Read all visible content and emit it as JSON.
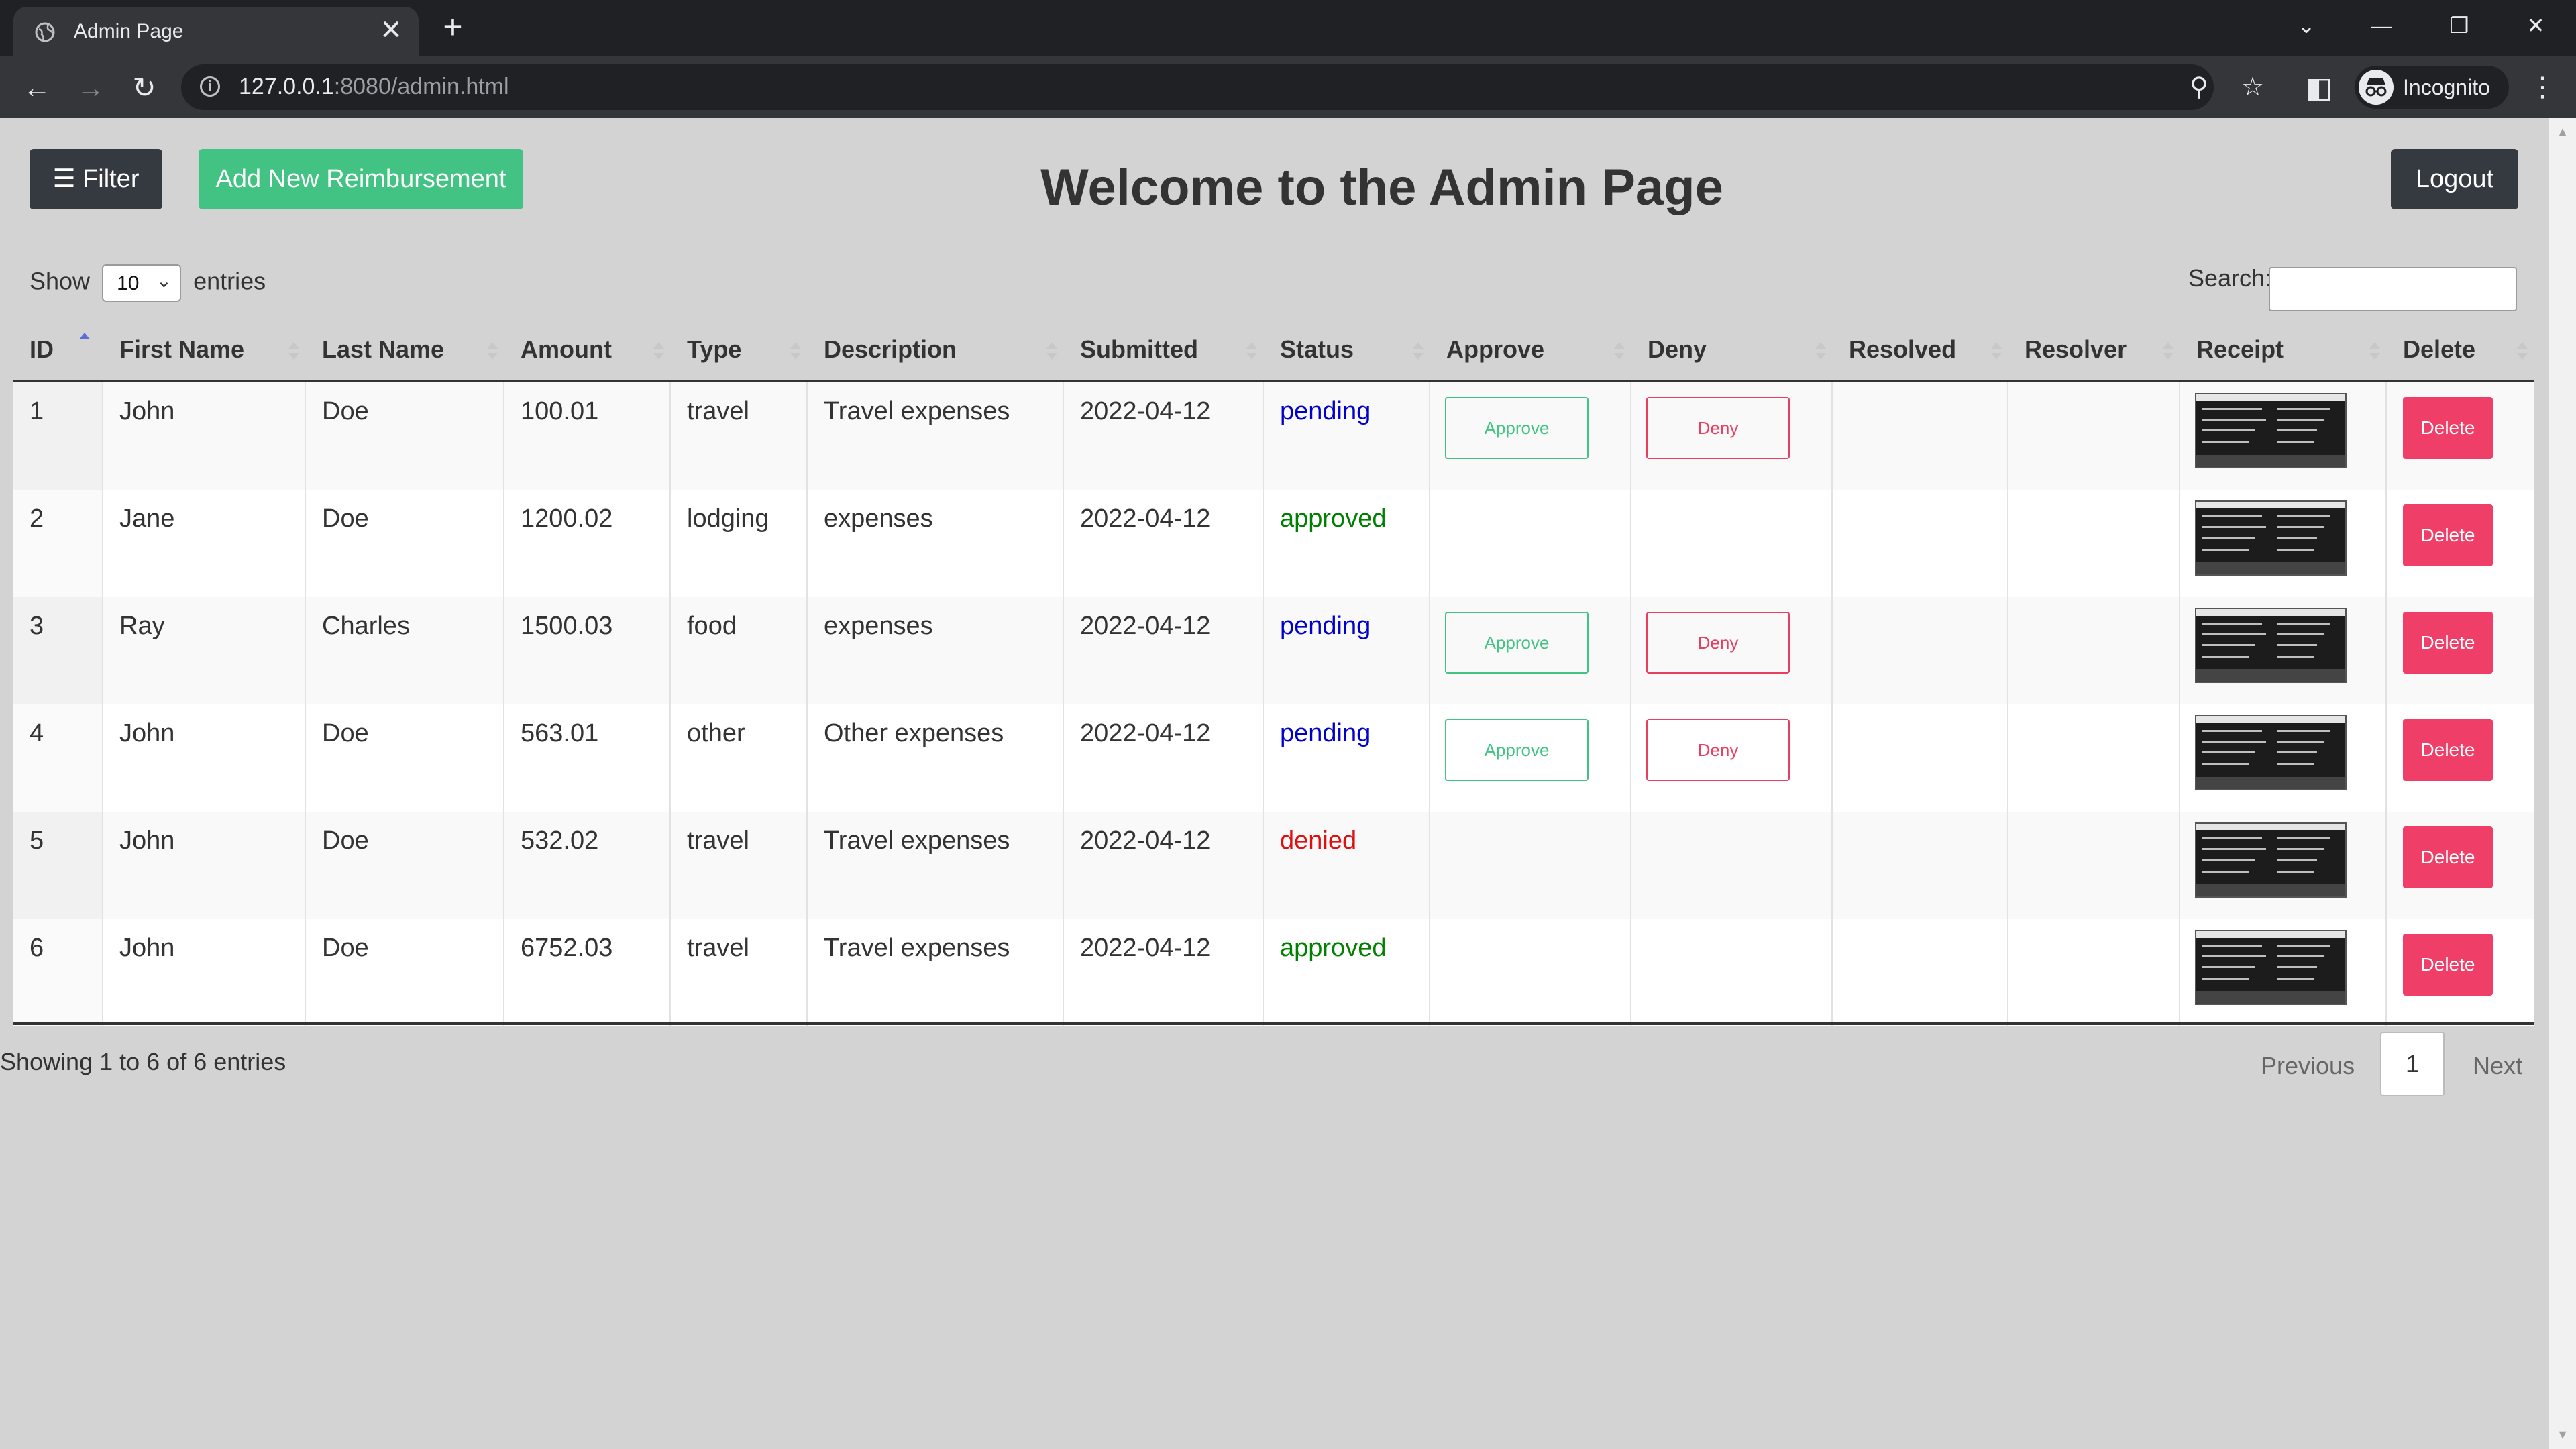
{
  "browser": {
    "tab_title": "Admin Page",
    "tab_close": "✕",
    "new_tab": "+",
    "url_host": "127.0.0.1",
    "url_rest": ":8080/admin.html",
    "profile_label": "Incognito",
    "window_controls": {
      "dropdown": "⌄",
      "minimize": "—",
      "restore": "❐",
      "close": "✕"
    }
  },
  "toolbar": {
    "filter_label": "☰ Filter",
    "add_label": "Add New Reimbursement",
    "logout_label": "Logout"
  },
  "heading": "Welcome to the Admin Page",
  "table_controls": {
    "show_label": "Show",
    "entries_label": "entries",
    "page_length": "10",
    "search_label": "Search:",
    "search_value": ""
  },
  "columns": [
    "ID",
    "First Name",
    "Last Name",
    "Amount",
    "Type",
    "Description",
    "Submitted",
    "Status",
    "Approve",
    "Deny",
    "Resolved",
    "Resolver",
    "Receipt",
    "Delete"
  ],
  "rows": [
    {
      "id": "1",
      "first": "John",
      "last": "Doe",
      "amount": "100.01",
      "type": "travel",
      "description": "Travel expenses",
      "submitted": "2022-04-12",
      "status": "pending",
      "resolved": "",
      "resolver": "",
      "approve": "Approve",
      "deny": "Deny",
      "delete": "Delete"
    },
    {
      "id": "2",
      "first": "Jane",
      "last": "Doe",
      "amount": "1200.02",
      "type": "lodging",
      "description": "expenses",
      "submitted": "2022-04-12",
      "status": "approved",
      "resolved": "",
      "resolver": "",
      "approve": "",
      "deny": "",
      "delete": "Delete"
    },
    {
      "id": "3",
      "first": "Ray",
      "last": "Charles",
      "amount": "1500.03",
      "type": "food",
      "description": "expenses",
      "submitted": "2022-04-12",
      "status": "pending",
      "resolved": "",
      "resolver": "",
      "approve": "Approve",
      "deny": "Deny",
      "delete": "Delete"
    },
    {
      "id": "4",
      "first": "John",
      "last": "Doe",
      "amount": "563.01",
      "type": "other",
      "description": "Other expenses",
      "submitted": "2022-04-12",
      "status": "pending",
      "resolved": "",
      "resolver": "",
      "approve": "Approve",
      "deny": "Deny",
      "delete": "Delete"
    },
    {
      "id": "5",
      "first": "John",
      "last": "Doe",
      "amount": "532.02",
      "type": "travel",
      "description": "Travel expenses",
      "submitted": "2022-04-12",
      "status": "denied",
      "resolved": "",
      "resolver": "",
      "approve": "",
      "deny": "",
      "delete": "Delete"
    },
    {
      "id": "6",
      "first": "John",
      "last": "Doe",
      "amount": "6752.03",
      "type": "travel",
      "description": "Travel expenses",
      "submitted": "2022-04-12",
      "status": "approved",
      "resolved": "",
      "resolver": "",
      "approve": "",
      "deny": "",
      "delete": "Delete"
    }
  ],
  "footer": {
    "info": "Showing 1 to 6 of 6 entries",
    "previous": "Previous",
    "current_page": "1",
    "next": "Next"
  },
  "colors": {
    "page_bg": "#d3d3d3",
    "dark_button": "#343a40",
    "success": "#42c384",
    "danger": "#ef3e67",
    "pending": "#0000cc",
    "approved": "#008000",
    "denied": "#e01010"
  }
}
